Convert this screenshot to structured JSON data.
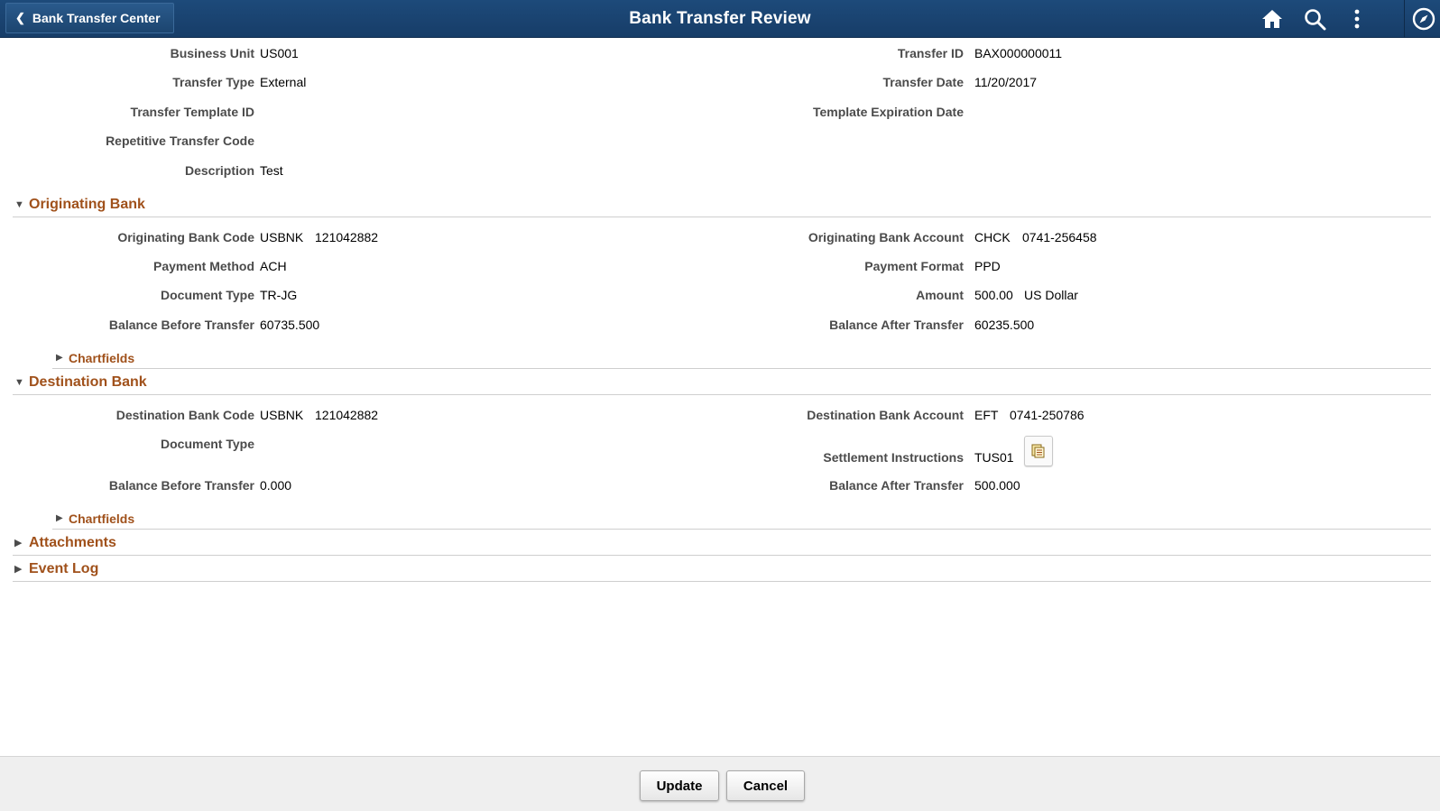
{
  "header": {
    "back_label": "Bank Transfer Center",
    "title": "Bank Transfer Review",
    "icons": [
      "home-icon",
      "search-icon",
      "actions-menu-icon",
      "navbar-compass-icon"
    ]
  },
  "summary": {
    "business_unit": {
      "label": "Business Unit",
      "value": "US001"
    },
    "transfer_type": {
      "label": "Transfer Type",
      "value": "External"
    },
    "template_id": {
      "label": "Transfer Template ID",
      "value": ""
    },
    "repetitive_code": {
      "label": "Repetitive Transfer Code",
      "value": ""
    },
    "description": {
      "label": "Description",
      "value": "Test"
    },
    "transfer_id": {
      "label": "Transfer ID",
      "value": "BAX000000011"
    },
    "transfer_date": {
      "label": "Transfer Date",
      "value": "11/20/2017"
    },
    "template_expiration": {
      "label": "Template Expiration Date",
      "value": ""
    }
  },
  "originating": {
    "section_title": "Originating Bank",
    "bank_code": {
      "label": "Originating Bank Code",
      "value1": "USBNK",
      "value2": "121042882"
    },
    "payment_method": {
      "label": "Payment Method",
      "value": "ACH"
    },
    "document_type": {
      "label": "Document Type",
      "value": "TR-JG"
    },
    "balance_before": {
      "label": "Balance Before Transfer",
      "value": "60735.500"
    },
    "bank_account": {
      "label": "Originating Bank Account",
      "value1": "CHCK",
      "value2": "0741-256458"
    },
    "payment_format": {
      "label": "Payment Format",
      "value": "PPD"
    },
    "amount": {
      "label": "Amount",
      "value1": "500.00",
      "value2": "US Dollar"
    },
    "balance_after": {
      "label": "Balance After Transfer",
      "value": "60235.500"
    },
    "chartfields": "Chartfields"
  },
  "destination": {
    "section_title": "Destination Bank",
    "bank_code": {
      "label": "Destination Bank Code",
      "value1": "USBNK",
      "value2": "121042882"
    },
    "document_type": {
      "label": "Document Type",
      "value": ""
    },
    "balance_before": {
      "label": "Balance Before Transfer",
      "value": "0.000"
    },
    "bank_account": {
      "label": "Destination Bank Account",
      "value1": "EFT",
      "value2": "0741-250786"
    },
    "settlement": {
      "label": "Settlement Instructions",
      "value": "TUS01"
    },
    "balance_after": {
      "label": "Balance After Transfer",
      "value": "500.000"
    },
    "chartfields": "Chartfields"
  },
  "sections": {
    "attachments": "Attachments",
    "event_log": "Event Log"
  },
  "footer": {
    "update_label": "Update",
    "cancel_label": "Cancel"
  },
  "colors": {
    "header_bg": "#1b4674",
    "section_title": "#a0511b",
    "label_text": "#4b4b4b"
  }
}
